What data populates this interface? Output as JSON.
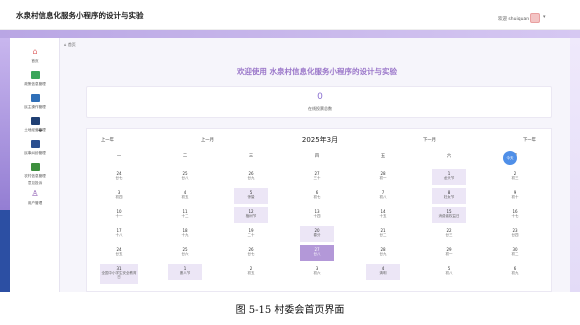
{
  "header": {
    "title": "水泉村信息化服务小程序的设计与实验",
    "welcome": "欢迎 shuiquan"
  },
  "breadcrumb": "首页",
  "sidebar": {
    "items": [
      {
        "label": "首页",
        "icon": "home-icon"
      },
      {
        "label": "政策信息管理",
        "icon": "grid-icon"
      },
      {
        "label": "民主操作管理",
        "icon": "folder-icon"
      },
      {
        "label": "土地经营管理",
        "icon": "doc-icon"
      },
      {
        "label": "民事纠纷管理",
        "icon": "list-icon"
      },
      {
        "label": "农村信息管理",
        "icon": "bag-icon"
      },
      {
        "label": "意见投诉",
        "icon": "person-icon"
      },
      {
        "label": "用户管理",
        "icon": "user-icon"
      }
    ]
  },
  "main": {
    "welcome": "欢迎使用 水泉村信息化服务小程序的设计与实验",
    "stat_value": "0",
    "stat_label": "在线投票总数"
  },
  "calendar": {
    "prev_year": "上一年",
    "prev_month": "上一月",
    "month": "2025年3月",
    "next_month": "下一月",
    "next_year": "下一年",
    "weekdays": [
      "一",
      "二",
      "三",
      "四",
      "五",
      "六",
      "日"
    ],
    "today_label": "今天",
    "weeks": [
      [
        {
          "d": "24",
          "s": "廿七"
        },
        {
          "d": "25",
          "s": "廿八"
        },
        {
          "d": "26",
          "s": "廿九"
        },
        {
          "d": "27",
          "s": "三十"
        },
        {
          "d": "28",
          "s": "初一"
        },
        {
          "d": "1",
          "s": "龙头节"
        },
        {
          "d": "2",
          "s": "初三"
        }
      ],
      [
        {
          "d": "3",
          "s": "初四"
        },
        {
          "d": "4",
          "s": "初五"
        },
        {
          "d": "5",
          "s": "惊蛰"
        },
        {
          "d": "6",
          "s": "初七"
        },
        {
          "d": "7",
          "s": "初八"
        },
        {
          "d": "8",
          "s": "妇女节"
        },
        {
          "d": "9",
          "s": "初十"
        }
      ],
      [
        {
          "d": "10",
          "s": "十一"
        },
        {
          "d": "11",
          "s": "十二"
        },
        {
          "d": "12",
          "s": "植树节"
        },
        {
          "d": "13",
          "s": "十四"
        },
        {
          "d": "14",
          "s": "十五"
        },
        {
          "d": "15",
          "s": "消费者权益日"
        },
        {
          "d": "16",
          "s": "十七"
        }
      ],
      [
        {
          "d": "17",
          "s": "十八"
        },
        {
          "d": "18",
          "s": "十九"
        },
        {
          "d": "19",
          "s": "二十"
        },
        {
          "d": "20",
          "s": "春分"
        },
        {
          "d": "21",
          "s": "廿二"
        },
        {
          "d": "22",
          "s": "廿三"
        },
        {
          "d": "23",
          "s": "廿四"
        }
      ],
      [
        {
          "d": "24",
          "s": "廿五"
        },
        {
          "d": "25",
          "s": "廿六"
        },
        {
          "d": "26",
          "s": "廿七"
        },
        {
          "d": "27",
          "s": "廿八"
        },
        {
          "d": "28",
          "s": "廿九"
        },
        {
          "d": "29",
          "s": "初一"
        },
        {
          "d": "30",
          "s": "初二"
        }
      ],
      [
        {
          "d": "31",
          "s": "全国中小学生安全教育日"
        },
        {
          "d": "1",
          "s": "愚人节"
        },
        {
          "d": "2",
          "s": "初五"
        },
        {
          "d": "3",
          "s": "初六"
        },
        {
          "d": "4",
          "s": "清明"
        },
        {
          "d": "5",
          "s": "初八"
        },
        {
          "d": "6",
          "s": "初九"
        }
      ]
    ]
  },
  "caption": "图 5-15 村委会首页界面",
  "colors": {
    "accent": "#9a76c9",
    "event_bg": "#ece6f6",
    "selected_bg": "#b398d8",
    "today": "#4f8fe8"
  }
}
